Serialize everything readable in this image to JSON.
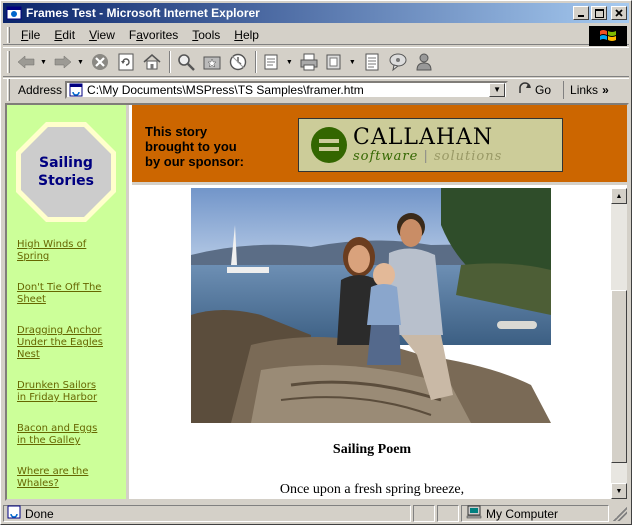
{
  "window": {
    "title": "Frames Test - Microsoft Internet Explorer",
    "controls": {
      "minimize": "_",
      "maximize": "□",
      "close": "×"
    }
  },
  "menu": {
    "items": [
      {
        "label": "File",
        "accel": "F"
      },
      {
        "label": "Edit",
        "accel": "E"
      },
      {
        "label": "View",
        "accel": "V"
      },
      {
        "label": "Favorites",
        "accel": "a"
      },
      {
        "label": "Tools",
        "accel": "T"
      },
      {
        "label": "Help",
        "accel": "H"
      }
    ]
  },
  "toolbar": {
    "buttons": [
      "back-icon",
      "forward-icon",
      "stop-icon",
      "refresh-icon",
      "home-icon",
      "search-icon",
      "favorites-icon",
      "history-icon",
      "mail-icon",
      "print-icon",
      "edit-icon",
      "discuss-icon",
      "messenger-icon"
    ]
  },
  "address": {
    "label": "Address",
    "value": "C:\\My Documents\\MSPress\\TS Samples\\framer.htm",
    "go_label": "Go",
    "links_label": "Links",
    "links_chevron": "»"
  },
  "left_frame": {
    "heading_line1": "Sailing",
    "heading_line2": "Stories",
    "links": [
      {
        "line1": "High Winds of",
        "line2": "Spring"
      },
      {
        "line1": "Don't Tie Off The",
        "line2": "Sheet"
      },
      {
        "line1": "Dragging Anchor",
        "line2": "Under the Eagles",
        "line3": "Nest"
      },
      {
        "line1": "Drunken Sailors",
        "line2": "in Friday Harbor"
      },
      {
        "line1": "Bacon and Eggs",
        "line2": "in the Galley"
      },
      {
        "line1": "Where are the",
        "line2": "Whales?"
      }
    ],
    "background_color": "#ccff99",
    "link_color": "#666600"
  },
  "top_frame": {
    "sponsor_line1": "This story",
    "sponsor_line2": "brought to you",
    "sponsor_line3": "by our sponsor:",
    "logo_name": "CALLAHAN",
    "logo_tagline_left": "software",
    "logo_tagline_right": "solutions",
    "background_color": "#cc6600"
  },
  "main_frame": {
    "poem_title": "Sailing Poem",
    "poem_first_line": "Once upon a fresh spring breeze,"
  },
  "status": {
    "text": "Done",
    "zone": "My Computer"
  }
}
